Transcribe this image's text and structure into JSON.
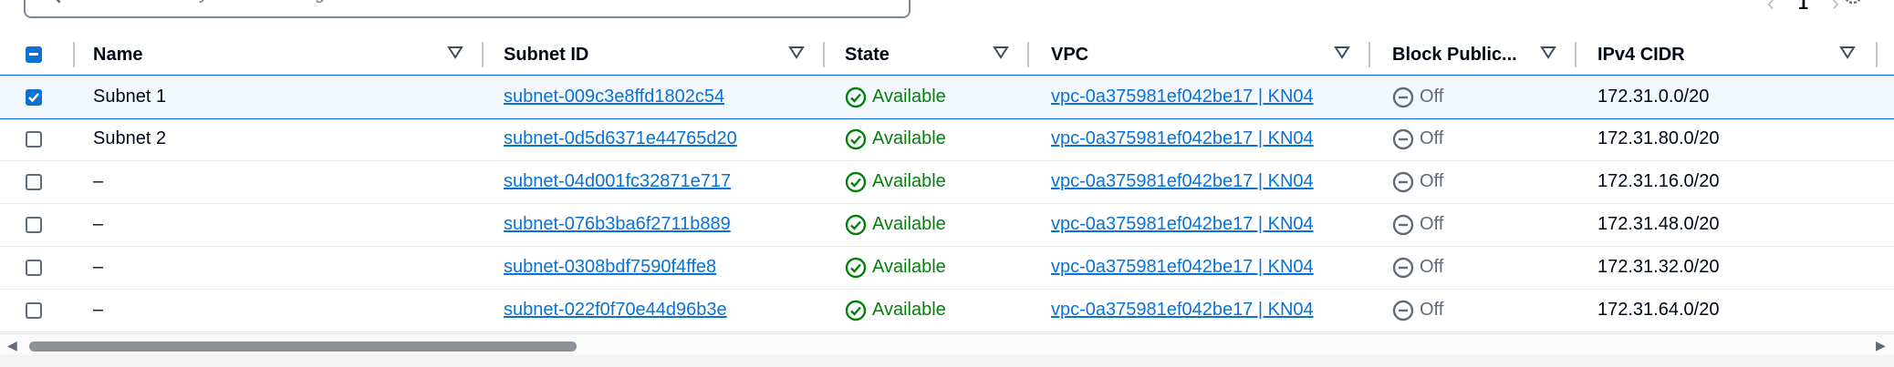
{
  "search": {
    "placeholder": "Find resources by attribute or tag"
  },
  "pagination": {
    "prev": "‹",
    "page": "1",
    "next": "›"
  },
  "columns": [
    "Name",
    "Subnet ID",
    "State",
    "VPC",
    "Block Public...",
    "IPv4 CIDR"
  ],
  "rows": [
    {
      "selected": true,
      "name": "Subnet 1",
      "subnet_id": "subnet-009c3e8ffd1802c54",
      "state": "Available",
      "vpc": "vpc-0a375981ef042be17 | KN04",
      "block": "Off",
      "cidr": "172.31.0.0/20"
    },
    {
      "selected": false,
      "name": "Subnet 2",
      "subnet_id": "subnet-0d5d6371e44765d20",
      "state": "Available",
      "vpc": "vpc-0a375981ef042be17 | KN04",
      "block": "Off",
      "cidr": "172.31.80.0/20"
    },
    {
      "selected": false,
      "name": "–",
      "subnet_id": "subnet-04d001fc32871e717",
      "state": "Available",
      "vpc": "vpc-0a375981ef042be17 | KN04",
      "block": "Off",
      "cidr": "172.31.16.0/20"
    },
    {
      "selected": false,
      "name": "–",
      "subnet_id": "subnet-076b3ba6f2711b889",
      "state": "Available",
      "vpc": "vpc-0a375981ef042be17 | KN04",
      "block": "Off",
      "cidr": "172.31.48.0/20"
    },
    {
      "selected": false,
      "name": "–",
      "subnet_id": "subnet-0308bdf7590f4ffe8",
      "state": "Available",
      "vpc": "vpc-0a375981ef042be17 | KN04",
      "block": "Off",
      "cidr": "172.31.32.0/20"
    },
    {
      "selected": false,
      "name": "–",
      "subnet_id": "subnet-022f0f70e44d96b3e",
      "state": "Available",
      "vpc": "vpc-0a375981ef042be17 | KN04",
      "block": "Off",
      "cidr": "172.31.64.0/20"
    }
  ],
  "colors": {
    "link": "#0972d3",
    "success": "#037f0c",
    "muted": "#5f6b7a",
    "selected_bg": "#f2f8fd"
  },
  "icons": {
    "search": "search-icon",
    "settings": "gear-icon",
    "sort": "caret-down-icon",
    "available": "check-circle-icon",
    "off": "minus-circle-icon"
  }
}
